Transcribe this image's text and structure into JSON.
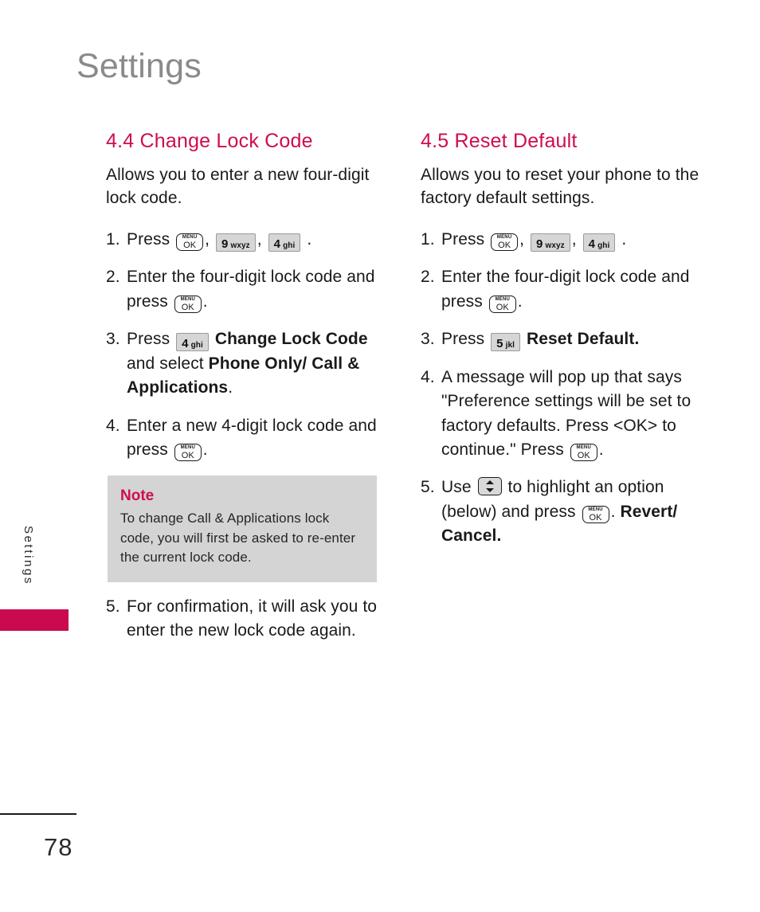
{
  "page": {
    "chapter_title": "Settings",
    "side_tab_label": "Settings",
    "page_number": "78",
    "accent_color": "#ce0d4f",
    "title_color": "#8a8a8a",
    "note_bg_color": "#d4d4d4"
  },
  "keys": {
    "menu_ok_top": "MENU",
    "menu_ok_bottom": "OK",
    "nine": {
      "digit": "9",
      "letters": "wxyz"
    },
    "four": {
      "digit": "4",
      "letters": "ghi"
    },
    "five": {
      "digit": "5",
      "letters": "jkl"
    }
  },
  "left_column": {
    "heading": "4.4 Change Lock Code",
    "intro": "Allows you to enter a new four-digit lock code.",
    "steps": {
      "s1_num": "1.",
      "s1_a": "Press",
      "s1_comma1": ",",
      "s1_comma2": ",",
      "s1_period": ".",
      "s2_num": "2.",
      "s2_a": "Enter the four-digit lock code and press",
      "s2_period": ".",
      "s3_num": "3.",
      "s3_a": "Press",
      "s3_b": "Change Lock Code",
      "s3_c": "and select",
      "s3_d": "Phone Only/ Call & Applications",
      "s3_period": ".",
      "s4_num": "4.",
      "s4_a": "Enter a new 4-digit lock code and press",
      "s4_period": ".",
      "s5_num": "5.",
      "s5_a": "For confirmation, it will ask you to enter the new lock code again."
    },
    "note": {
      "title": "Note",
      "body": "To change Call & Applications lock code, you will first be asked to re-enter the current lock code."
    }
  },
  "right_column": {
    "heading": "4.5 Reset Default",
    "intro": "Allows you to reset your phone to the factory default settings.",
    "steps": {
      "s1_num": "1.",
      "s1_a": "Press",
      "s1_comma1": ",",
      "s1_comma2": ",",
      "s1_period": ".",
      "s2_num": "2.",
      "s2_a": "Enter the four-digit lock code and press",
      "s2_period": ".",
      "s3_num": "3.",
      "s3_a": "Press",
      "s3_b": "Reset Default.",
      "s4_num": "4.",
      "s4_a": "A message will pop up that says \"Preference settings will be set to factory defaults. Press <OK> to continue.\"",
      "s4_b": "Press",
      "s4_period": ".",
      "s5_num": "5.",
      "s5_a": "Use",
      "s5_b": "to highlight an option (below) and press",
      "s5_period": ".",
      "s5_options": "Revert/ Cancel."
    }
  }
}
